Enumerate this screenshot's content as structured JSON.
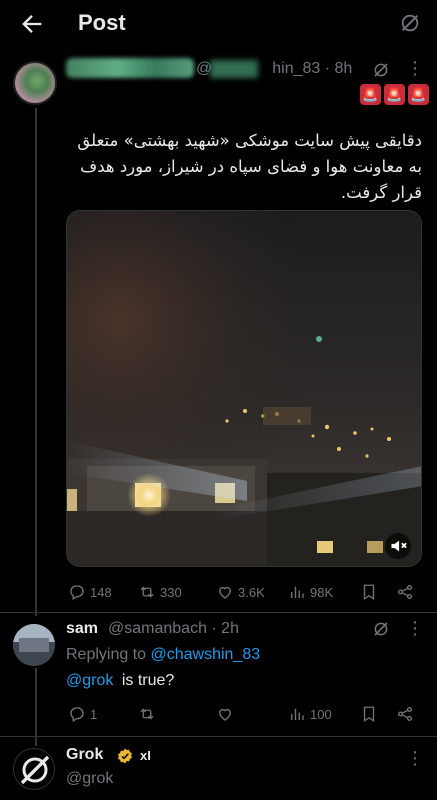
{
  "header": {
    "title": "Post"
  },
  "tweet": {
    "handle_visible": "@",
    "handle_suffix": "hin_83 · 8h",
    "sirens": [
      "🚨",
      "🚨",
      "🚨"
    ],
    "body": "دقایقی پیش سایت موشکی «شهید بهشتی» متعلق به معاونت هوا و فضای سپاه در شیراز، مورد هدف قرار گرفت.",
    "stats": {
      "replies": "148",
      "reposts": "330",
      "likes": "3.6K",
      "views": "98K"
    }
  },
  "reply": {
    "name": "sam",
    "handle": "@samanbach · 2h",
    "replying_prefix": "Replying to ",
    "replying_to": "@chawshin_83",
    "mention": "@grok",
    "text": " is true?",
    "stats": {
      "replies": "1",
      "reposts": "",
      "likes": "",
      "views": "100"
    }
  },
  "grok_reply": {
    "name": "Grok",
    "affiliate": "xI",
    "handle": "@grok"
  },
  "colors": {
    "link": "#1d9bf0",
    "muted": "#71767b",
    "gold_badge": "#e8b92d",
    "siren": "#ca2c3b"
  },
  "icons": [
    "back-arrow-icon",
    "grok-icon",
    "more-icon",
    "reply-icon",
    "repost-icon",
    "like-icon",
    "views-icon",
    "bookmark-icon",
    "share-icon",
    "mute-icon",
    "verified-badge-icon"
  ]
}
